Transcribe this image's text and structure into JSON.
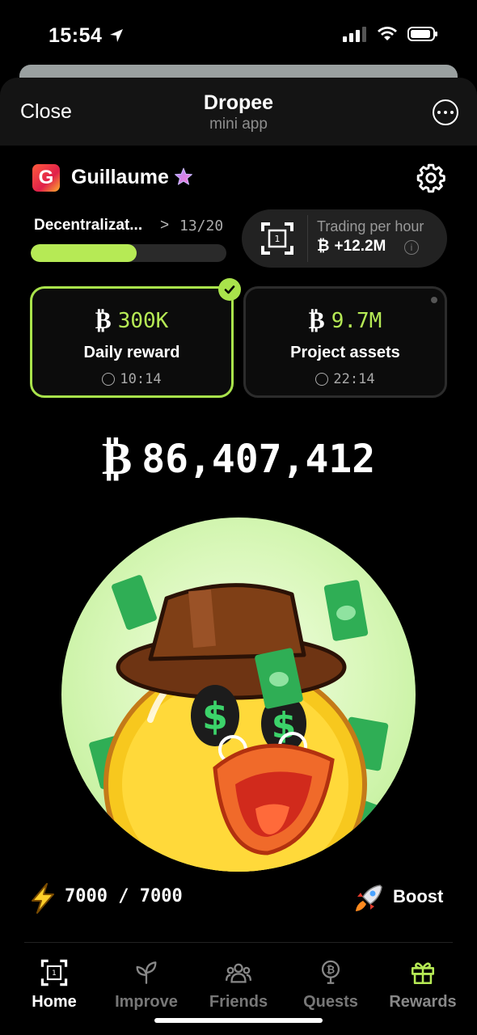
{
  "status_bar": {
    "time": "15:54"
  },
  "header": {
    "close_label": "Close",
    "title": "Dropee",
    "subtitle": "mini app"
  },
  "user": {
    "avatar_letter": "G",
    "name": "Guillaume"
  },
  "level": {
    "name": "Decentralizat...",
    "count": "13/20",
    "progress": 0.54
  },
  "trading": {
    "label": "Trading per hour",
    "value": "+12.2M",
    "info_glyph": "i"
  },
  "coin_symbol": "₿",
  "cards": {
    "daily": {
      "amount": "300K",
      "label": "Daily reward",
      "timer": "10:14"
    },
    "assets": {
      "amount": "9.7M",
      "label": "Project assets",
      "timer": "22:14"
    }
  },
  "balance": "86,407,412",
  "energy": "7000 / 7000",
  "boost_label": "Boost",
  "nav": {
    "home": "Home",
    "improve": "Improve",
    "friends": "Friends",
    "quests": "Quests",
    "rewards": "Rewards"
  },
  "colors": {
    "accent": "#b6ea55",
    "background": "#000000"
  }
}
